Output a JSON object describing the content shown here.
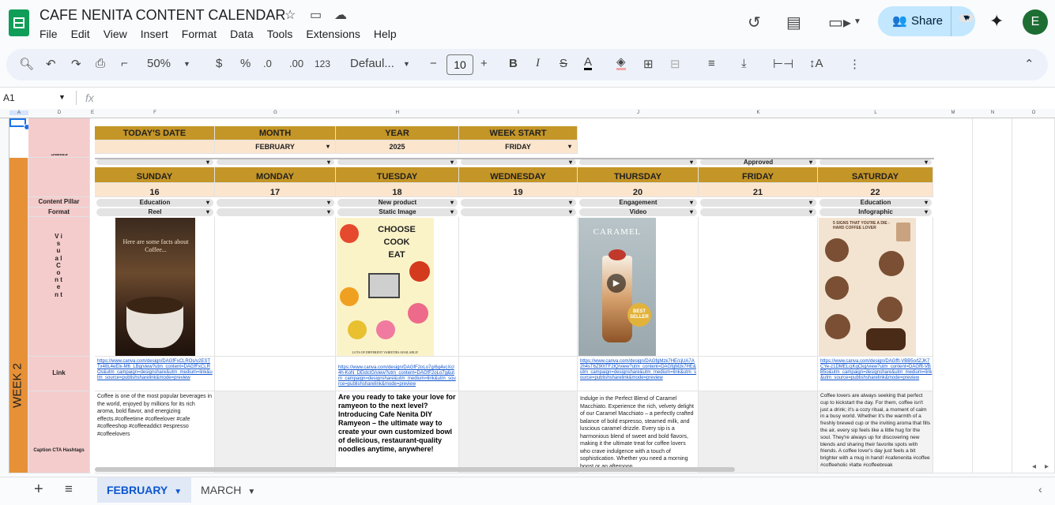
{
  "app": {
    "doc_title": "CAFE NENITA CONTENT CALENDAR",
    "menu": [
      "File",
      "Edit",
      "View",
      "Insert",
      "Format",
      "Data",
      "Tools",
      "Extensions",
      "Help"
    ],
    "share_label": "Share",
    "avatar_letter": "E"
  },
  "toolbar": {
    "zoom": "50%",
    "currency": "$",
    "percent": "%",
    "dec_down": ".0",
    "dec_up": ".00",
    "number_format": "123",
    "font": "Defaul...",
    "font_size": "10"
  },
  "formula_bar": {
    "name_box": "A1",
    "fx": "fx"
  },
  "columns": [
    "A",
    "D",
    "E",
    "F",
    "G",
    "H",
    "I",
    "J",
    "K",
    "L",
    "M",
    "N",
    "O"
  ],
  "sheet": {
    "week_label": "WEEK 2",
    "top_headers": [
      "TODAY'S DATE",
      "MONTH",
      "YEAR",
      "WEEK START"
    ],
    "top_values": {
      "month": "FEBRUARY",
      "year": "2025",
      "week_start": "FRIDAY"
    },
    "status_label": "Status",
    "status_friday": "Approved",
    "days": [
      "SUNDAY",
      "MONDAY",
      "TUESDAY",
      "WEDNESDAY",
      "THURSDAY",
      "FRIDAY",
      "SATURDAY"
    ],
    "dates": [
      "16",
      "17",
      "18",
      "19",
      "20",
      "21",
      "22"
    ],
    "row_labels": {
      "pillar": "Content Pillar",
      "format": "Format",
      "visual": "V i s u a l   C o n t e n t",
      "link": "Link",
      "caption": "Caption CTA Hashtags"
    },
    "pillars": [
      "Education",
      "",
      "New product",
      "",
      "Engagement",
      "",
      "Education"
    ],
    "formats": [
      "Reel",
      "",
      "Static Image",
      "",
      "Video",
      "",
      "Infographic"
    ],
    "links": [
      "https://www.canva.com/design/DAGfFxCLROs/v2ESTTx48L4eElx-M6_LBg/view?utm_content=DAGfFxCLROs&utm_campaign=designshare&utm_medium=link&utm_source=publishsharelink&mode=preview",
      "",
      "https://www.canva.com/design/DAGfF2oLo7g/6g4vcXcl4h-KoN_DEidcIG/view?utm_content=DAGfF2oLo7g&utm_campaign=designshare&utm_medium=link&utm_source=publishsharelink&mode=preview",
      "",
      "https://www.canva.com/design/DAGfgMzk7HE/cjUA7A2h4sT6Z90tTF2lQ/view?utm_content=DAGfgMzk7HE&utm_campaign=designshare&utm_medium=link&utm_source=publishsharelink&mode=preview",
      "",
      "https://www.canva.com/design/DAGfft-VBB5o/tZJK7CYe-z1DMELcjKqCkg/view?utm_content=DAGfft-VBB5o&utm_campaign=designshare&utm_medium=link&utm_source=publishsharelink&mode=preview"
    ],
    "captions": {
      "sunday": "Coffee is one of the most popular beverages in the world, enjoyed by millions for its rich aroma, bold flavor, and energizing effects.#coffeetime #coffeelover #cafe #coffeeshop #coffeeaddict #espresso #coffeelovers",
      "tuesday": "Are you ready to take your love for ramyeon to the next level? Introducing Cafe Nenita DIY Ramyeon – the ultimate way to create your own customized bowl of delicious, restaurant-quality noodles anytime, anywhere!",
      "thursday": "Indulge in the Perfect Blend of Caramel Macchiato. Experience the rich, velvety delight of our Caramel Macchiato – a perfectly crafted balance of bold espresso, steamed milk, and luscious caramel drizzle. Every sip is a harmonious blend of sweet and bold flavors, making it the ultimate treat for coffee lovers who crave indulgence with a touch of sophistication. Whether you need a morning boost or an afternoon",
      "saturday": "Coffee lovers are always seeking that perfect cup to kickstart the day. For them, coffee isn't just a drink; it's a cozy ritual, a moment of calm in a busy world. Whether it's the warmth of a freshly brewed cup or the inviting aroma that fills the air, every sip feels like a little hug for the soul. They're always up for discovering new blends and sharing their favorite spots with friends. A coffee lover's day just feels a bit brighter with a mug in hand! #cafenenita #coffee #coffeeholic #latte #coffeebreak"
    },
    "images": {
      "sunday_text": "Here are some facts about Coffee...",
      "tuesday_title": [
        "CHOOSE",
        "COOK",
        "EAT"
      ],
      "tuesday_footer": "LOTS OF DIFFERENT VARIETIES AVAILABLE!",
      "thursday_title": "CARAMEL",
      "thursday_badge": "BEST SELLER",
      "saturday_title": "5 SIGNS THAT YOU'RE A DIE - HARD COFFEE LOVER"
    }
  },
  "tabs": [
    "FEBRUARY",
    "MARCH"
  ]
}
